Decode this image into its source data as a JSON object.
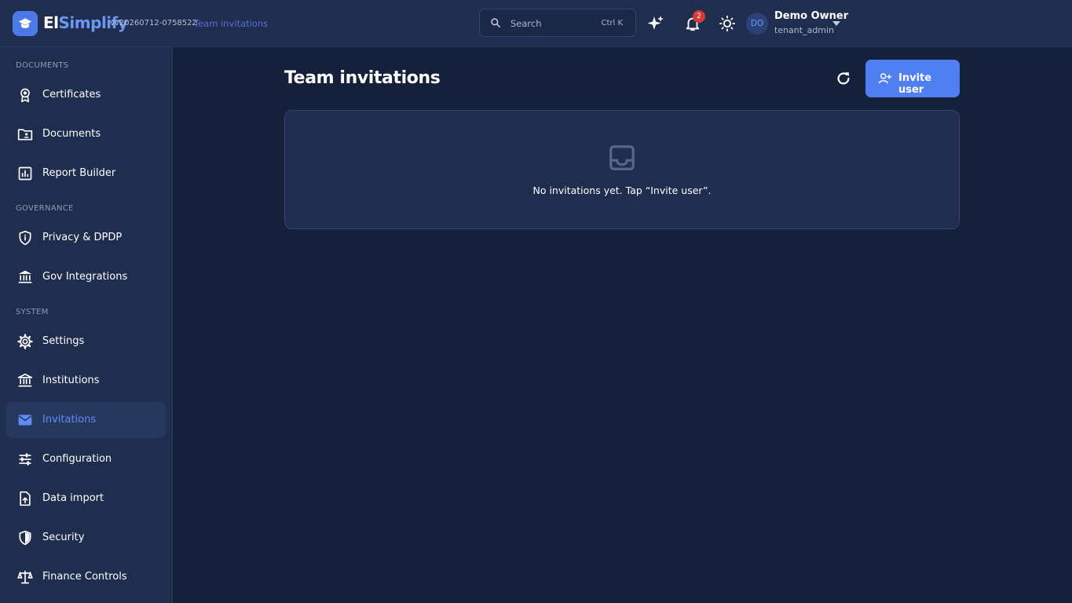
{
  "app": {
    "brand_part1": "El",
    "brand_part2": "Simplify",
    "version": "vv20260712-075852Z",
    "breadcrumb": "Team invitations",
    "accent_color": "#4f7ff1"
  },
  "header": {
    "search_placeholder": "Search",
    "search_shortcut": "Ctrl K",
    "notification_count": "2",
    "user": {
      "initials": "DO",
      "name": "Demo Owner",
      "role": "tenant_admin"
    }
  },
  "sidebar": {
    "sections": [
      {
        "title": "DOCUMENTS",
        "items": [
          {
            "label": "Certificates",
            "icon": "award-icon"
          },
          {
            "label": "Documents",
            "icon": "folder-user-icon"
          },
          {
            "label": "Report Builder",
            "icon": "bar-chart-icon"
          }
        ]
      },
      {
        "title": "GOVERNANCE",
        "items": [
          {
            "label": "Privacy & DPDP",
            "icon": "shield-info-icon"
          },
          {
            "label": "Gov Integrations",
            "icon": "bank-icon"
          }
        ]
      },
      {
        "title": "SYSTEM",
        "items": [
          {
            "label": "Settings",
            "icon": "gear-icon"
          },
          {
            "label": "Institutions",
            "icon": "institution-icon"
          },
          {
            "label": "Invitations",
            "icon": "mail-icon",
            "active": true
          },
          {
            "label": "Configuration",
            "icon": "sliders-icon"
          },
          {
            "label": "Data import",
            "icon": "file-upload-icon"
          },
          {
            "label": "Security",
            "icon": "shield-icon"
          },
          {
            "label": "Finance Controls",
            "icon": "scale-icon"
          }
        ]
      }
    ]
  },
  "main": {
    "title": "Team invitations",
    "invite_button": "Invite user",
    "empty_message": "No invitations yet. Tap “Invite user”."
  }
}
